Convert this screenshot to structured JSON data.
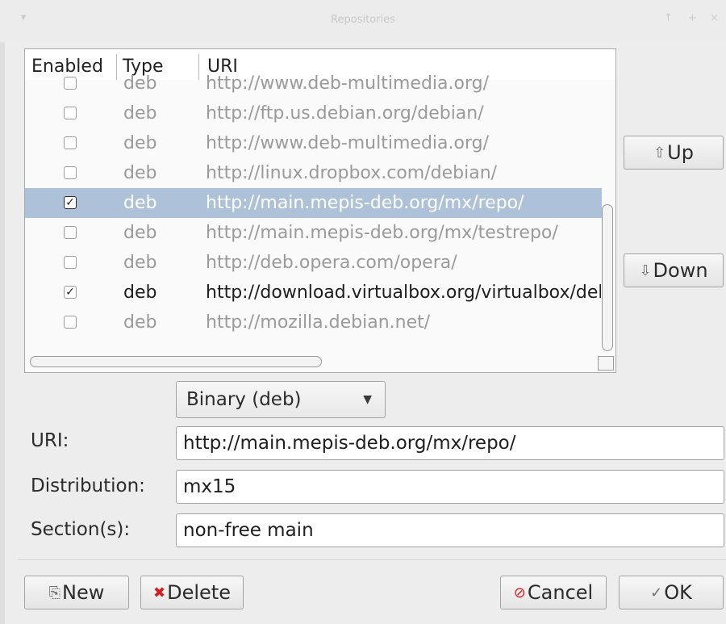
{
  "window": {
    "title": "Repositories",
    "controls": [
      "↑",
      "+",
      "×"
    ]
  },
  "table": {
    "headers": {
      "enabled": "Enabled",
      "type": "Type",
      "uri": "URI"
    },
    "rows": [
      {
        "enabled": false,
        "type": "deb",
        "uri": "http://www.deb-multimedia.org/"
      },
      {
        "enabled": false,
        "type": "deb",
        "uri": "http://ftp.us.debian.org/debian/"
      },
      {
        "enabled": false,
        "type": "deb",
        "uri": "http://www.deb-multimedia.org/"
      },
      {
        "enabled": false,
        "type": "deb",
        "uri": "http://linux.dropbox.com/debian/"
      },
      {
        "enabled": true,
        "type": "deb",
        "uri": "http://main.mepis-deb.org/mx/repo/",
        "selected": true
      },
      {
        "enabled": false,
        "type": "deb",
        "uri": "http://main.mepis-deb.org/mx/testrepo/"
      },
      {
        "enabled": false,
        "type": "deb",
        "uri": "http://deb.opera.com/opera/"
      },
      {
        "enabled": true,
        "type": "deb",
        "uri": "http://download.virtualbox.org/virtualbox/debian"
      },
      {
        "enabled": false,
        "type": "deb",
        "uri": "http://mozilla.debian.net/"
      }
    ]
  },
  "side_buttons": {
    "up": "Up",
    "down": "Down"
  },
  "form": {
    "type_value": "Binary (deb)",
    "uri_label": "URI:",
    "uri_value": "http://main.mepis-deb.org/mx/repo/",
    "distribution_label": "Distribution:",
    "distribution_value": "mx15",
    "sections_label": "Section(s):",
    "sections_value": "non-free main"
  },
  "footer": {
    "new": "New",
    "delete": "Delete",
    "cancel": "Cancel",
    "ok": "OK"
  },
  "colors": {
    "selection": "#adc2d8",
    "delete_icon": "#d31e1e",
    "disabled_text": "#9a9a9a"
  }
}
